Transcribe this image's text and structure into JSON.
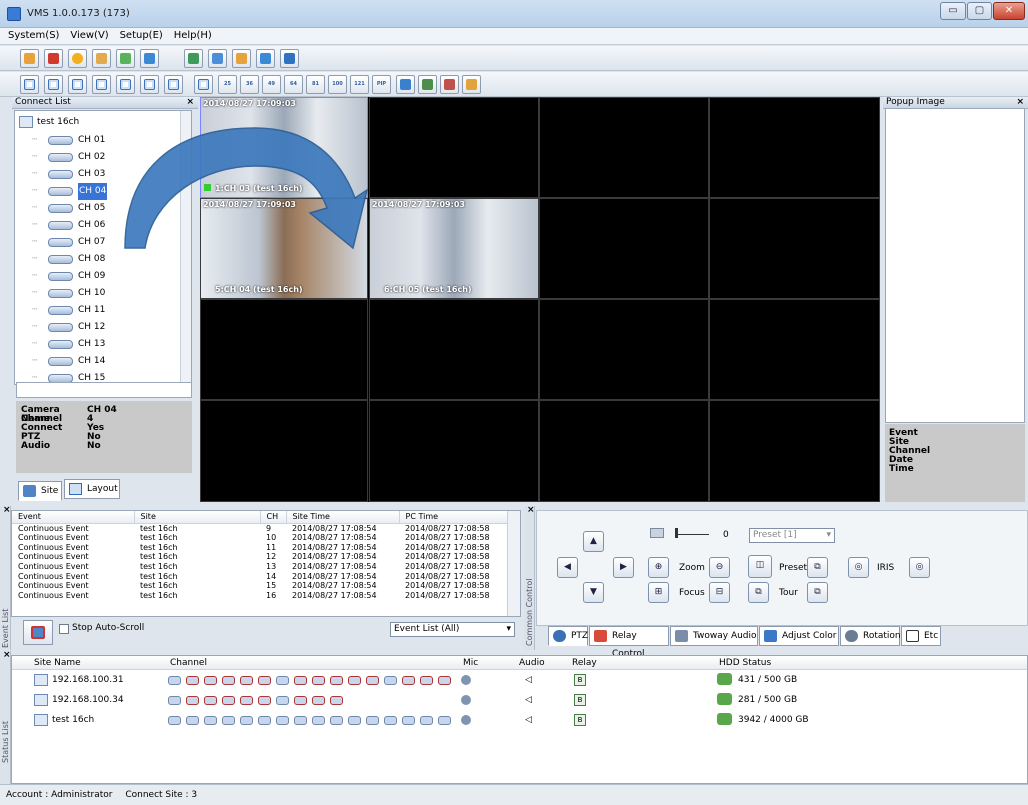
{
  "window": {
    "title": "VMS 1.0.0.173 (173)",
    "minimize": "▭",
    "maximize": "▢",
    "close": "✕"
  },
  "menu": [
    "System(S)",
    "View(V)",
    "Setup(E)",
    "Help(H)"
  ],
  "layout_buttons": [
    "25",
    "36",
    "49",
    "64",
    "81",
    "100",
    "121",
    "PIP"
  ],
  "connect": {
    "title": "Connect List",
    "site": "test 16ch",
    "channels": [
      "CH 01",
      "CH 02",
      "CH 03",
      "CH 04",
      "CH 05",
      "CH 06",
      "CH 07",
      "CH 08",
      "CH 09",
      "CH 10",
      "CH 11",
      "CH 12",
      "CH 13",
      "CH 14",
      "CH 15",
      "CH 16"
    ],
    "selected_index": 3,
    "info": [
      {
        "k": "Camera Name",
        "v": "CH 04"
      },
      {
        "k": "Channel",
        "v": "4"
      },
      {
        "k": "Connect",
        "v": "Yes"
      },
      {
        "k": "PTZ",
        "v": "No"
      },
      {
        "k": "Audio",
        "v": "No"
      }
    ],
    "tab_site": "Site",
    "tab_layout": "Layout"
  },
  "video": [
    {
      "ts": "2014/08/27 17:09:03",
      "label": "1:CH 03 (test 16ch)"
    },
    {
      "ts": "2014/08/27 17:09:03",
      "label": "5:CH 04 (test 16ch)"
    },
    {
      "ts": "2014/08/27 17:09:03",
      "label": "6:CH 05 (test 16ch)"
    }
  ],
  "popup": {
    "title": "Popup Image",
    "fields": [
      "Event",
      "Site",
      "Channel",
      "Date",
      "Time"
    ]
  },
  "events": {
    "columns": [
      "Event",
      "Site",
      "CH",
      "Site Time",
      "PC Time"
    ],
    "rows": [
      [
        "Continuous Event",
        "test 16ch",
        "9",
        "2014/08/27 17:08:54",
        "2014/08/27 17:08:58"
      ],
      [
        "Continuous Event",
        "test 16ch",
        "10",
        "2014/08/27 17:08:54",
        "2014/08/27 17:08:58"
      ],
      [
        "Continuous Event",
        "test 16ch",
        "11",
        "2014/08/27 17:08:54",
        "2014/08/27 17:08:58"
      ],
      [
        "Continuous Event",
        "test 16ch",
        "12",
        "2014/08/27 17:08:54",
        "2014/08/27 17:08:58"
      ],
      [
        "Continuous Event",
        "test 16ch",
        "13",
        "2014/08/27 17:08:54",
        "2014/08/27 17:08:58"
      ],
      [
        "Continuous Event",
        "test 16ch",
        "14",
        "2014/08/27 17:08:54",
        "2014/08/27 17:08:58"
      ],
      [
        "Continuous Event",
        "test 16ch",
        "15",
        "2014/08/27 17:08:54",
        "2014/08/27 17:08:58"
      ],
      [
        "Continuous Event",
        "test 16ch",
        "16",
        "2014/08/27 17:08:54",
        "2014/08/27 17:08:58"
      ]
    ],
    "stop_autoscroll": "Stop Auto-Scroll",
    "filter": "Event List (All)",
    "side_label": "Event List"
  },
  "ptz": {
    "side_label": "Common Control",
    "speed_value": "0",
    "preset_select": "Preset [1]",
    "zoom": "Zoom",
    "focus": "Focus",
    "preset": "Preset",
    "tour": "Tour",
    "iris": "IRIS",
    "tabs": [
      "PTZ",
      "Relay Control",
      "Twoway Audio",
      "Adjust Color",
      "Rotation",
      "Etc"
    ]
  },
  "status": {
    "side_label": "Status List",
    "columns": [
      "Site Name",
      "Channel",
      "Mic",
      "Audio",
      "Relay",
      "HDD Status"
    ],
    "rows": [
      {
        "site": "192.168.100.31",
        "hdd": "431 / 500 GB"
      },
      {
        "site": "192.168.100.34",
        "hdd": "281 / 500 GB"
      },
      {
        "site": "test 16ch",
        "hdd": "3942 / 4000 GB"
      }
    ]
  },
  "footer": {
    "account": "Account : Administrator",
    "connect": "Connect Site : 3"
  }
}
